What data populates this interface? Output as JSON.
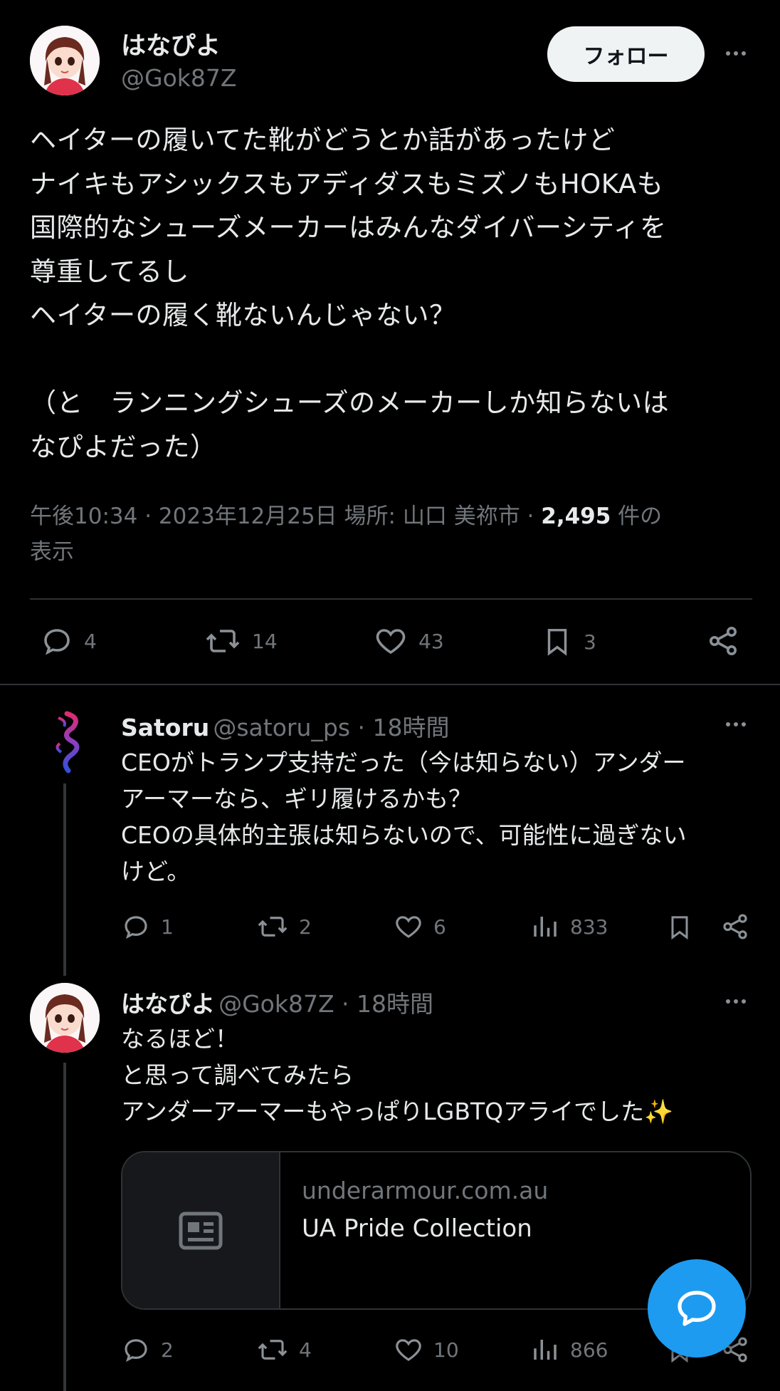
{
  "main_tweet": {
    "display_name": "はなぴよ",
    "handle": "@Gok87Z",
    "follow_label": "フォロー",
    "text": "ヘイターの履いてた靴がどうとか話があったけど\nナイキもアシックスもアディダスもミズノもHOKAも\n国際的なシューズメーカーはみんなダイバーシティを\n尊重してるし\nヘイターの履く靴ないんじゃない？\n\n（と　ランニングシューズのメーカーしか知らないは\nなぴよだった）",
    "time": "午後10:34 · 2023年12月25日 場所: 山口 美祢市 · ",
    "views_count": "2,495",
    "views_suffix": " 件の",
    "views_label": "表示",
    "stats": {
      "replies": "4",
      "retweets": "14",
      "likes": "43",
      "bookmarks": "3"
    }
  },
  "replies": [
    {
      "display_name": "Satoru",
      "handle": "@satoru_ps · 18時間",
      "text": "CEOがトランプ支持だった（今は知らない）アンダー\nアーマーなら、ギリ履けるかも？\nCEOの具体的主張は知らないので、可能性に過ぎない\nけど。",
      "stats": {
        "replies": "1",
        "retweets": "2",
        "likes": "6",
        "views": "833"
      }
    },
    {
      "display_name": "はなぴよ",
      "handle": "@Gok87Z · 18時間",
      "text": "なるほど！\nと思って調べてみたら\nアンダーアーマーもやっぱりLGBTQアライでした✨",
      "link_card": {
        "domain": "underarmour.com.au",
        "title": "UA Pride Collection"
      },
      "stats": {
        "replies": "2",
        "retweets": "4",
        "likes": "10",
        "views": "866"
      }
    }
  ],
  "icons": {
    "reply": "comment-icon",
    "retweet": "retweet-icon",
    "like": "heart-icon",
    "bookmark": "bookmark-icon",
    "share": "share-icon",
    "views": "analytics-icon",
    "more": "more-icon",
    "compose": "chat-bubble-icon",
    "article": "article-icon"
  },
  "colors": {
    "background": "#000000",
    "text": "#e7e9ea",
    "muted": "#71767b",
    "accent": "#1d9bf0",
    "follow_bg": "#eff3f4"
  }
}
